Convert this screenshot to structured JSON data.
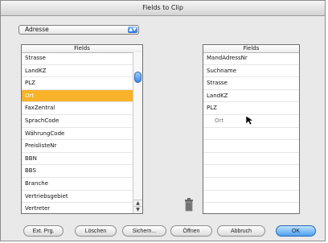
{
  "window": {
    "title": "Fields to Clip"
  },
  "popup": {
    "value": "Adresse"
  },
  "left_list": {
    "header": "Fields",
    "items": [
      "Strasse",
      "LandKZ",
      "PLZ",
      "Ort",
      "FaxZentral",
      "SprachCode",
      "WährungCode",
      "PreislisteNr",
      "BBN",
      "BBS",
      "Branche",
      "Vertriebsgebiet",
      "Vertreter"
    ],
    "selected_index": 3
  },
  "right_list": {
    "header": "Fields",
    "items": [
      "MandAdressNr",
      "Suchname",
      "Strasse",
      "LandKZ",
      "PLZ"
    ],
    "dragging_item": "Ort"
  },
  "icons": {
    "trash": "trash-icon",
    "cursor": "pointer-cursor-icon",
    "popup_arrows": "updown-arrows-icon",
    "scroll_up": "arrow-up-icon",
    "scroll_down": "arrow-down-icon"
  },
  "buttons": {
    "ext_prg": "Ext. Prg.",
    "loeschen": "Löschen",
    "sichern": "Sichern...",
    "oeffnen": "Öffnen",
    "abbruch": "Abbruch",
    "ok": "OK"
  },
  "colors": {
    "selection": "#f8b32a",
    "primary": "#4da0ef"
  }
}
